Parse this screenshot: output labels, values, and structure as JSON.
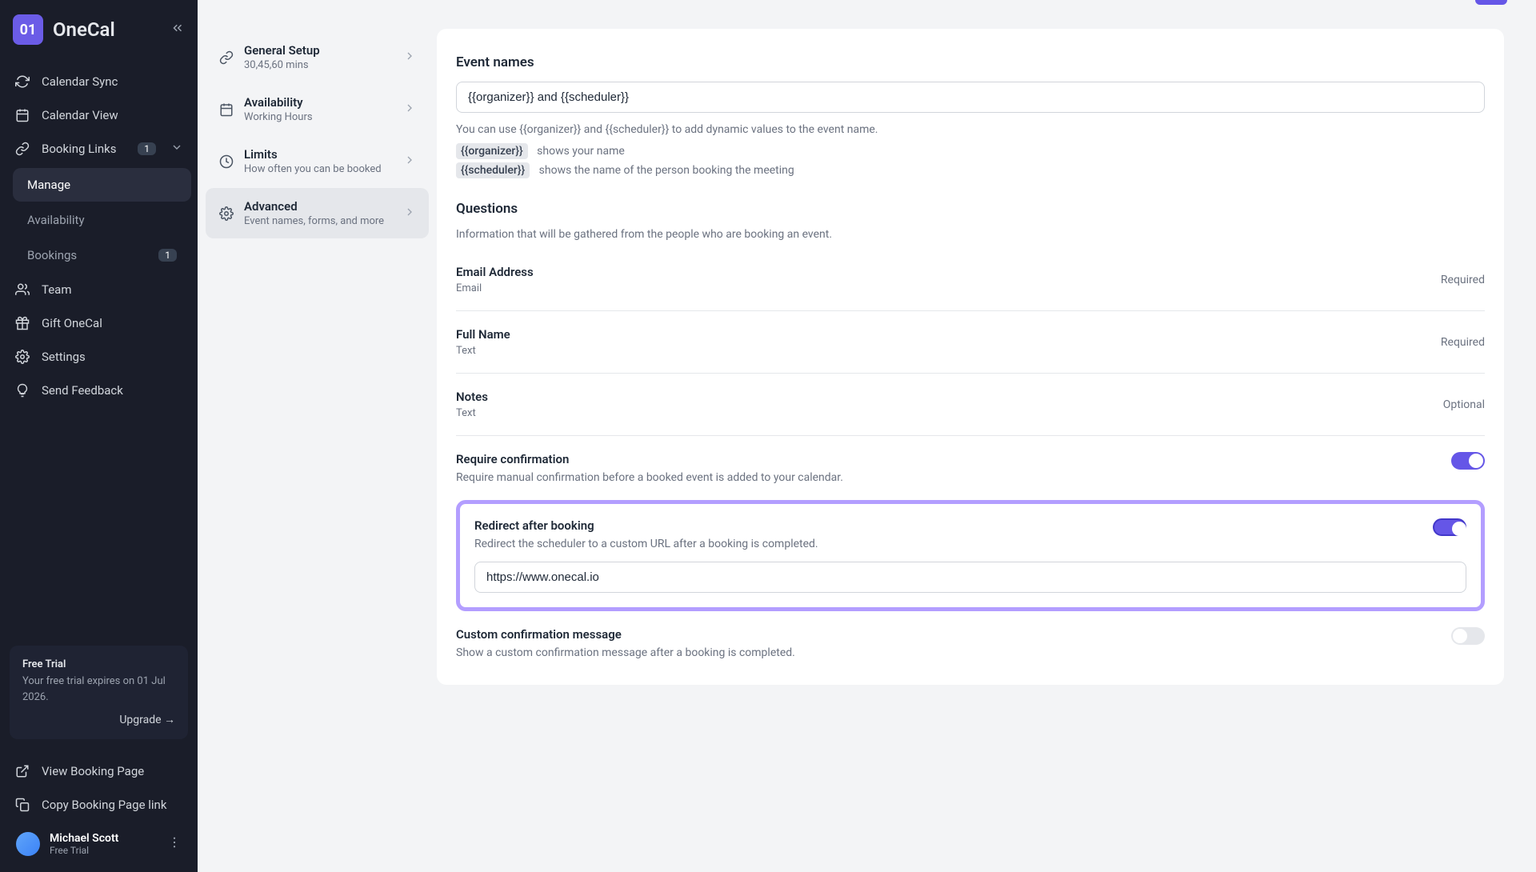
{
  "brand": "OneCal",
  "logo_text": "01",
  "nav": {
    "calendar_sync": "Calendar Sync",
    "calendar_view": "Calendar View",
    "booking_links": "Booking Links",
    "booking_links_badge": "1",
    "sub": {
      "manage": "Manage",
      "availability": "Availability",
      "bookings": "Bookings",
      "bookings_badge": "1"
    },
    "team": "Team",
    "gift": "Gift OneCal",
    "settings": "Settings",
    "feedback": "Send Feedback",
    "view_booking": "View Booking Page",
    "copy_link": "Copy Booking Page link"
  },
  "trial": {
    "title": "Free Trial",
    "desc": "Your free trial expires on 01 Jul 2026.",
    "upgrade": "Upgrade →"
  },
  "user": {
    "name": "Michael Scott",
    "plan": "Free Trial"
  },
  "settings_panel": {
    "general": {
      "title": "General Setup",
      "subtitle": "30,45,60 mins"
    },
    "availability": {
      "title": "Availability",
      "subtitle": "Working Hours"
    },
    "limits": {
      "title": "Limits",
      "subtitle": "How often you can be booked"
    },
    "advanced": {
      "title": "Advanced",
      "subtitle": "Event names, forms, and more"
    }
  },
  "content": {
    "event_names": {
      "title": "Event names",
      "value": "{{organizer}} and {{scheduler}}",
      "help": "You can use {{organizer}} and {{scheduler}} to add dynamic values to the event name.",
      "token1": "{{organizer}}",
      "token1_desc": "shows your name",
      "token2": "{{scheduler}}",
      "token2_desc": "shows the name of the person booking the meeting"
    },
    "questions": {
      "title": "Questions",
      "desc": "Information that will be gathered from the people who are booking an event.",
      "items": [
        {
          "name": "Email Address",
          "type": "Email",
          "status": "Required"
        },
        {
          "name": "Full Name",
          "type": "Text",
          "status": "Required"
        },
        {
          "name": "Notes",
          "type": "Text",
          "status": "Optional"
        }
      ]
    },
    "require_confirm": {
      "title": "Require confirmation",
      "desc": "Require manual confirmation before a booked event is added to your calendar."
    },
    "redirect": {
      "title": "Redirect after booking",
      "desc": "Redirect the scheduler to a custom URL after a booking is completed.",
      "url": "https://www.onecal.io"
    },
    "custom_msg": {
      "title": "Custom confirmation message",
      "desc": "Show a custom confirmation message after a booking is completed."
    }
  }
}
